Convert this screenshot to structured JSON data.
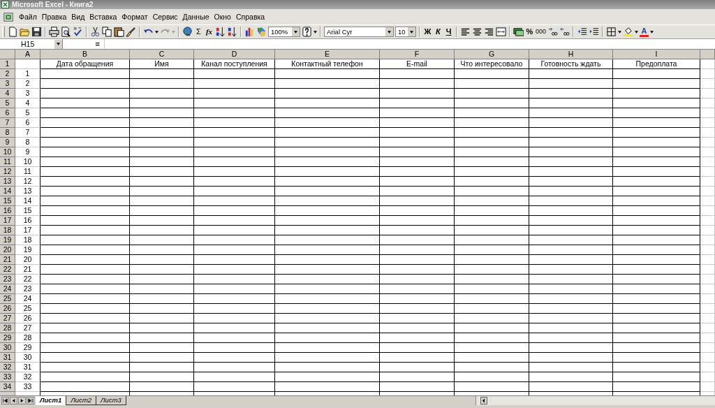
{
  "window": {
    "title": "Microsoft Excel - Книга2"
  },
  "menu": [
    "Файл",
    "Правка",
    "Вид",
    "Вставка",
    "Формат",
    "Сервис",
    "Данные",
    "Окно",
    "Справка"
  ],
  "toolbar": {
    "sum": "Σ",
    "function": "fx",
    "zoom": "100%",
    "font": "Arial Cyr",
    "font_size": "10",
    "bold": "Ж",
    "italic": "К",
    "underline": "Ч",
    "percent": "%",
    "thousands": "000",
    "font_color": "A"
  },
  "formula_bar": {
    "name_box": "H15",
    "equals": "="
  },
  "sheet": {
    "columns": [
      "A",
      "B",
      "C",
      "D",
      "E",
      "F",
      "G",
      "H",
      "I"
    ],
    "header_row": {
      "number": "1",
      "titles": [
        "Дата обращения",
        "Имя",
        "Канал поступления",
        "Контактный телефон",
        "E-mail",
        "Что интересовало",
        "Готовность ждать",
        "Предоплата"
      ]
    },
    "rows": [
      {
        "number": "2",
        "a": "1"
      },
      {
        "number": "3",
        "a": "2"
      },
      {
        "number": "4",
        "a": "3"
      },
      {
        "number": "5",
        "a": "4"
      },
      {
        "number": "6",
        "a": "5"
      },
      {
        "number": "7",
        "a": "6"
      },
      {
        "number": "8",
        "a": "7"
      },
      {
        "number": "9",
        "a": "8"
      },
      {
        "number": "10",
        "a": "9"
      },
      {
        "number": "11",
        "a": "10"
      },
      {
        "number": "12",
        "a": "11"
      },
      {
        "number": "13",
        "a": "12"
      },
      {
        "number": "14",
        "a": "13"
      },
      {
        "number": "15",
        "a": "14"
      },
      {
        "number": "16",
        "a": "15"
      },
      {
        "number": "17",
        "a": "16"
      },
      {
        "number": "18",
        "a": "17"
      },
      {
        "number": "19",
        "a": "18"
      },
      {
        "number": "20",
        "a": "19"
      },
      {
        "number": "21",
        "a": "20"
      },
      {
        "number": "22",
        "a": "21"
      },
      {
        "number": "23",
        "a": "22"
      },
      {
        "number": "24",
        "a": "23"
      },
      {
        "number": "25",
        "a": "24"
      },
      {
        "number": "26",
        "a": "25"
      },
      {
        "number": "27",
        "a": "26"
      },
      {
        "number": "28",
        "a": "27"
      },
      {
        "number": "29",
        "a": "28"
      },
      {
        "number": "30",
        "a": "29"
      },
      {
        "number": "31",
        "a": "30"
      },
      {
        "number": "32",
        "a": "31"
      },
      {
        "number": "33",
        "a": "32"
      },
      {
        "number": "34",
        "a": "33"
      }
    ]
  },
  "sheet_tabs": [
    {
      "label": "Лист1",
      "selected": true
    },
    {
      "label": "Лист2",
      "selected": false
    },
    {
      "label": "Лист3",
      "selected": false
    }
  ]
}
